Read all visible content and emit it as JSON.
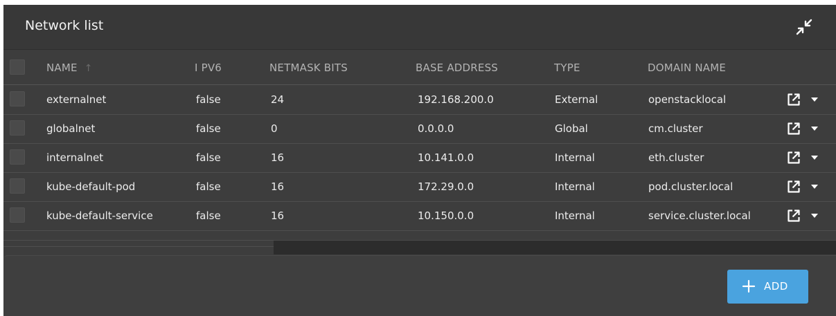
{
  "panel": {
    "title": "Network list"
  },
  "table": {
    "columns": {
      "name": "NAME",
      "ipv6": "I PV6",
      "netmask": "NETMASK BITS",
      "base": "BASE ADDRESS",
      "type": "TYPE",
      "domain": "DOMAIN NAME"
    },
    "sort": {
      "column": "NAME",
      "direction": "ascending",
      "icon": "arrow-up-icon"
    },
    "rows": [
      {
        "name": "externalnet",
        "ipv6": "false",
        "netmask": "24",
        "base": "192.168.200.0",
        "type": "External",
        "domain": "openstacklocal"
      },
      {
        "name": "globalnet",
        "ipv6": "false",
        "netmask": "0",
        "base": "0.0.0.0",
        "type": "Global",
        "domain": "cm.cluster"
      },
      {
        "name": "internalnet",
        "ipv6": "false",
        "netmask": "16",
        "base": "10.141.0.0",
        "type": "Internal",
        "domain": "eth.cluster"
      },
      {
        "name": "kube-default-pod",
        "ipv6": "false",
        "netmask": "16",
        "base": "172.29.0.0",
        "type": "Internal",
        "domain": "pod.cluster.local"
      },
      {
        "name": "kube-default-service",
        "ipv6": "false",
        "netmask": "16",
        "base": "10.150.0.0",
        "type": "Internal",
        "domain": "service.cluster.local"
      }
    ]
  },
  "footer": {
    "add_label": "ADD"
  },
  "icons": {
    "collapse": "collapse-icon",
    "open": "open-external-icon",
    "menu": "caret-down-icon",
    "add": "plus-icon"
  },
  "colors": {
    "panel_bg": "#3d3d3d",
    "accent": "#4aa3df",
    "text": "#ececec",
    "header_text": "#b3b3b3"
  }
}
